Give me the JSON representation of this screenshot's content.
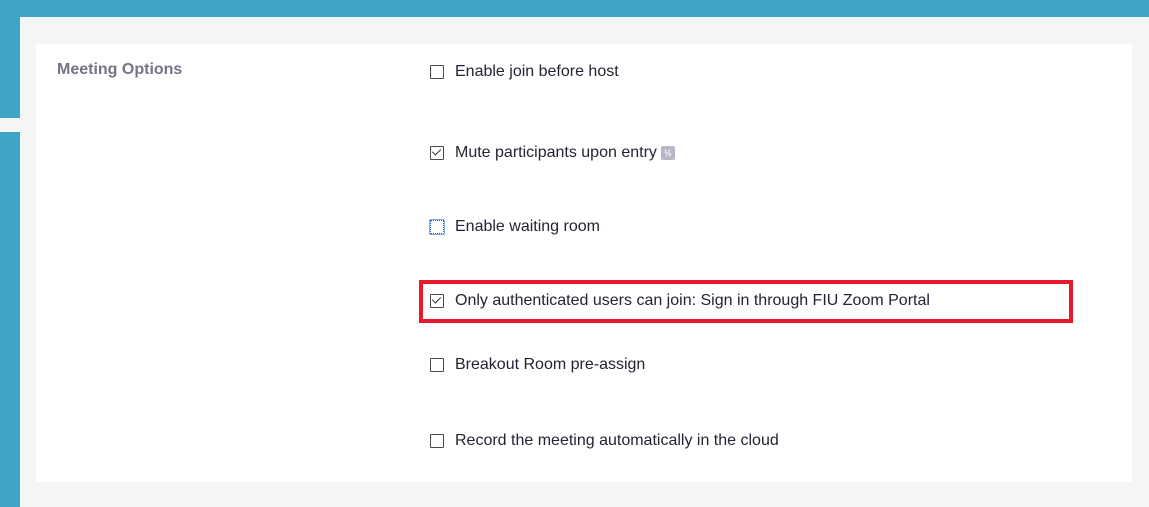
{
  "section": {
    "label": "Meeting Options"
  },
  "options": [
    {
      "label": "Enable join before host",
      "checked": false
    },
    {
      "label": "Mute participants upon entry",
      "checked": true,
      "badge": "½"
    },
    {
      "label": "Enable waiting room",
      "checked": false,
      "focused": true
    },
    {
      "label": "Only authenticated users can join: Sign in through FIU Zoom Portal",
      "checked": true,
      "highlighted": true
    },
    {
      "label": "Breakout Room pre-assign",
      "checked": false
    },
    {
      "label": "Record the meeting automatically in the cloud",
      "checked": false
    }
  ],
  "colors": {
    "background": "#3fa5c6",
    "highlight": "#e8192c",
    "label": "#747487"
  }
}
